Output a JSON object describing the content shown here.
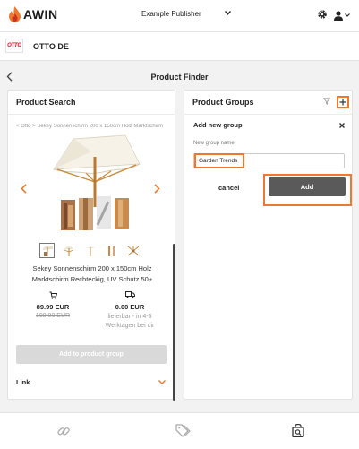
{
  "header": {
    "logo_text": "AWIN",
    "publisher_select": "Example Publisher",
    "icons": [
      "gear-icon",
      "user-icon",
      "chevron-down-icon"
    ]
  },
  "advertiser": {
    "logo_text": "OTTO",
    "name": "OTTO DE"
  },
  "page": {
    "title": "Product Finder"
  },
  "product_search": {
    "title": "Product Search",
    "breadcrumb": "< Otto > Sekey Sonnenschirm 200 x 150cm Holz Marktschirm",
    "product_title": "Sekey Sonnenschirm 200 x 150cm Holz Marktschirm Rechteckig, UV Schutz 50+",
    "price": "89.99 EUR",
    "old_price": "199.00 EUR",
    "shipping_price": "0.00 EUR",
    "delivery_text": "lieferbar - in 4-5 Werktagen bei dir",
    "add_button": "Add to product group",
    "link_label": "Link"
  },
  "product_groups": {
    "title": "Product Groups",
    "form_title": "Add new group",
    "field_label": "New group name",
    "field_value": "Garden Trends",
    "cancel_label": "cancel",
    "add_label": "Add"
  },
  "colors": {
    "accent": "#f0782d",
    "primary_button": "#5a5a5a",
    "disabled_button": "#d9d9d9",
    "otto_red": "#e2001a"
  },
  "bottom_nav": [
    "link-icon",
    "tag-icon",
    "product-search-icon"
  ]
}
